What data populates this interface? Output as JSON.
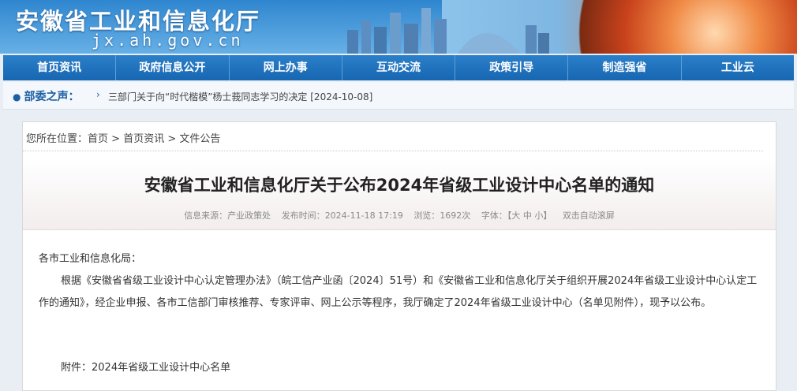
{
  "header": {
    "site_title": "安徽省工业和信息化厅",
    "domain": "jx.ah.gov.cn"
  },
  "nav": {
    "items": [
      "首页资讯",
      "政府信息公开",
      "网上办事",
      "互动交流",
      "政策引导",
      "制造强省",
      "工业云"
    ]
  },
  "ticker": {
    "label": "部委之声：",
    "message": "三部门关于向“时代楷模”杨士莪同志学习的决定 [2024-10-08]"
  },
  "breadcrumb": {
    "prefix": "您所在位置：",
    "home": "首页",
    "sep1": " > ",
    "section": "首页资讯",
    "sep2": " > ",
    "current": "文件公告"
  },
  "article": {
    "title": "安徽省工业和信息化厅关于公布2024年省级工业设计中心名单的通知",
    "source_label": "信息来源：",
    "source": "产业政策处",
    "date_label": "发布时间：",
    "date": "2024-11-18 17:19",
    "views_label": "浏览：",
    "views": "1692次",
    "font_label": "字体：",
    "font_open": "【",
    "font_large": "大",
    "font_medium": "中",
    "font_small": "小",
    "font_close": "】",
    "autoscroll": "双击自动滚屏",
    "salutation": "各市工业和信息化局：",
    "paragraph": "根据《安徽省省级工业设计中心认定管理办法》（皖工信产业函〔2024〕51号）和《安徽省工业和信息化厅关于组织开展2024年省级工业设计中心认定工作的通知》，经企业申报、各市工信部门审核推荐、专家评审、网上公示等程序，我厅确定了2024年省级工业设计中心（名单见附件），现予以公布。",
    "attachment": "附件：2024年省级工业设计中心名单"
  }
}
